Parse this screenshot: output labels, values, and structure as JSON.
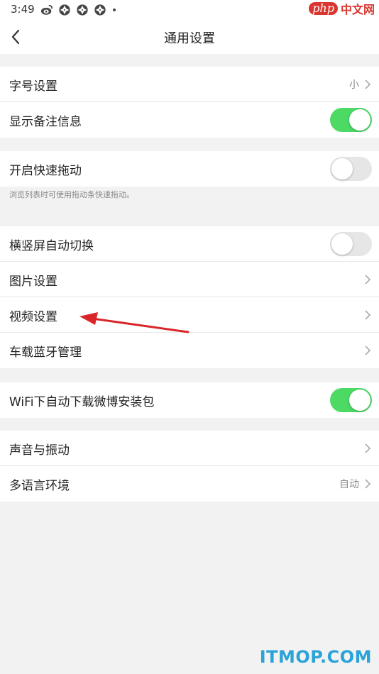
{
  "status_bar": {
    "time": "3:49",
    "icons": [
      "weibo-icon",
      "camera-aperture-icon",
      "camera-aperture-icon",
      "camera-aperture-icon",
      "dot-icon"
    ]
  },
  "watermarks": {
    "top_php": "php",
    "top_cn": "中文网",
    "bottom": "ITMOP.COM"
  },
  "header": {
    "title": "通用设置"
  },
  "groups": [
    {
      "rows": [
        {
          "label": "字号设置",
          "value": "小",
          "control": "chevron"
        },
        {
          "label": "显示备注信息",
          "control": "toggle",
          "on": true
        }
      ]
    },
    {
      "rows": [
        {
          "label": "开启快速拖动",
          "control": "toggle",
          "on": false
        }
      ],
      "hint": "浏览列表时可使用拖动条快速拖动。"
    },
    {
      "rows": [
        {
          "label": "横竖屏自动切换",
          "control": "toggle",
          "on": false
        },
        {
          "label": "图片设置",
          "control": "chevron"
        },
        {
          "label": "视频设置",
          "control": "chevron"
        },
        {
          "label": "车载蓝牙管理",
          "control": "chevron"
        }
      ]
    },
    {
      "rows": [
        {
          "label": "WiFi下自动下载微博安装包",
          "control": "toggle",
          "on": true
        }
      ]
    },
    {
      "rows": [
        {
          "label": "声音与振动",
          "control": "chevron"
        },
        {
          "label": "多语言环境",
          "value": "自动",
          "control": "chevron"
        }
      ]
    }
  ],
  "colors": {
    "toggle_on": "#4cd964",
    "toggle_off": "#e6e6e6",
    "annotation_arrow": "#d9262a",
    "watermark_bottom": "#2aa3d8"
  }
}
